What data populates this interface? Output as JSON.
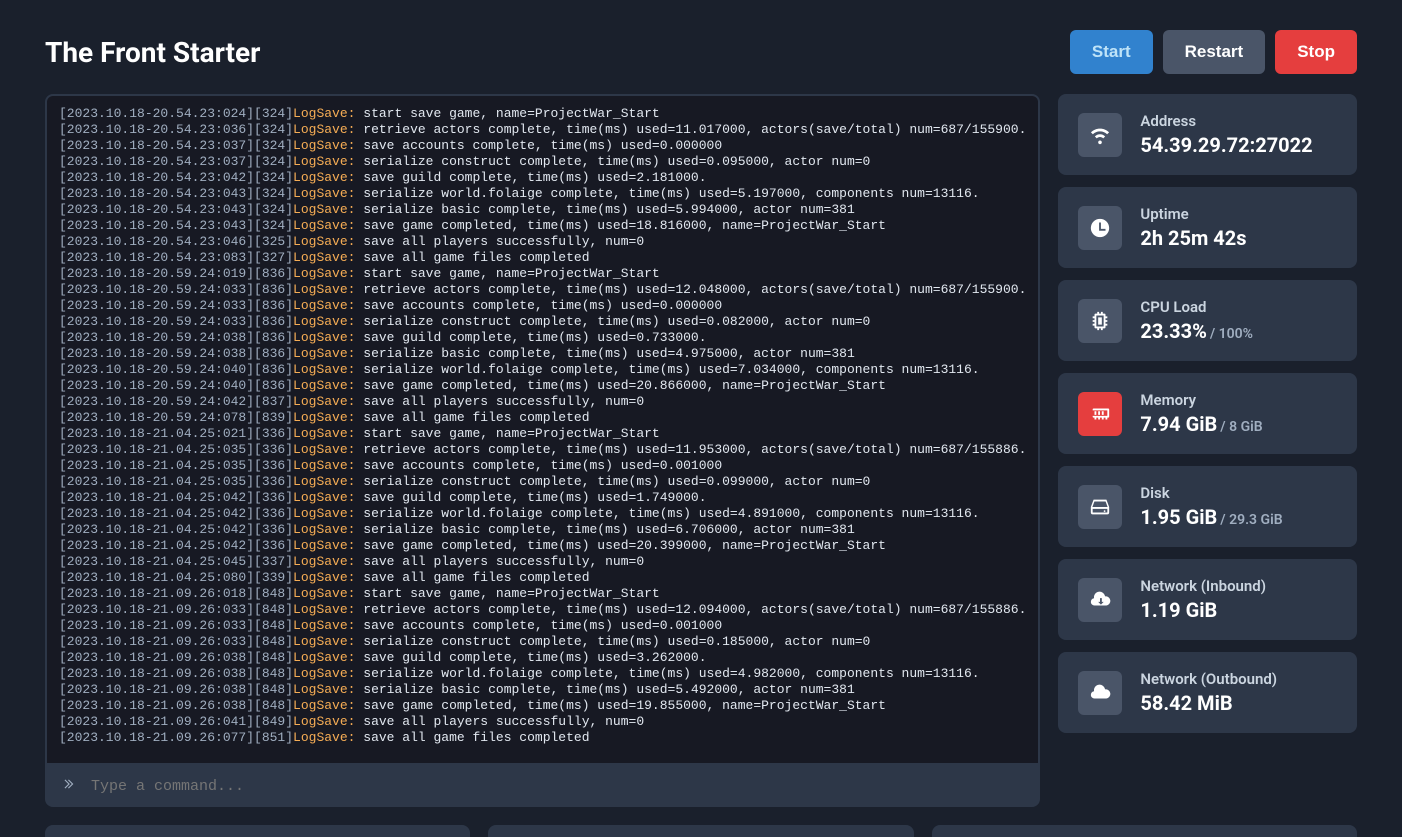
{
  "title": "The Front Starter",
  "buttons": {
    "start": "Start",
    "restart": "Restart",
    "stop": "Stop"
  },
  "console": {
    "placeholder": "Type a command...",
    "lines": [
      {
        "ts": "[2023.10.18-20.54.23:024][324]",
        "tag": "LogSave:",
        "msg": " start save game, name=ProjectWar_Start"
      },
      {
        "ts": "[2023.10.18-20.54.23:036][324]",
        "tag": "LogSave:",
        "msg": " retrieve actors complete, time(ms) used=11.017000, actors(save/total) num=687/155900."
      },
      {
        "ts": "[2023.10.18-20.54.23:037][324]",
        "tag": "LogSave:",
        "msg": " save accounts complete, time(ms) used=0.000000"
      },
      {
        "ts": "[2023.10.18-20.54.23:037][324]",
        "tag": "LogSave:",
        "msg": " serialize construct complete, time(ms) used=0.095000, actor num=0"
      },
      {
        "ts": "[2023.10.18-20.54.23:042][324]",
        "tag": "LogSave:",
        "msg": " save guild complete, time(ms) used=2.181000."
      },
      {
        "ts": "[2023.10.18-20.54.23:043][324]",
        "tag": "LogSave:",
        "msg": " serialize world.folaige complete, time(ms) used=5.197000, components num=13116."
      },
      {
        "ts": "[2023.10.18-20.54.23:043][324]",
        "tag": "LogSave:",
        "msg": " serialize basic complete, time(ms) used=5.994000, actor num=381"
      },
      {
        "ts": "[2023.10.18-20.54.23:043][324]",
        "tag": "LogSave:",
        "msg": " save game completed, time(ms) used=18.816000, name=ProjectWar_Start"
      },
      {
        "ts": "[2023.10.18-20.54.23:046][325]",
        "tag": "LogSave:",
        "msg": " save all players successfully, num=0"
      },
      {
        "ts": "[2023.10.18-20.54.23:083][327]",
        "tag": "LogSave:",
        "msg": " save all game files completed"
      },
      {
        "ts": "[2023.10.18-20.59.24:019][836]",
        "tag": "LogSave:",
        "msg": " start save game, name=ProjectWar_Start"
      },
      {
        "ts": "[2023.10.18-20.59.24:033][836]",
        "tag": "LogSave:",
        "msg": " retrieve actors complete, time(ms) used=12.048000, actors(save/total) num=687/155900."
      },
      {
        "ts": "[2023.10.18-20.59.24:033][836]",
        "tag": "LogSave:",
        "msg": " save accounts complete, time(ms) used=0.000000"
      },
      {
        "ts": "[2023.10.18-20.59.24:033][836]",
        "tag": "LogSave:",
        "msg": " serialize construct complete, time(ms) used=0.082000, actor num=0"
      },
      {
        "ts": "[2023.10.18-20.59.24:038][836]",
        "tag": "LogSave:",
        "msg": " save guild complete, time(ms) used=0.733000."
      },
      {
        "ts": "[2023.10.18-20.59.24:038][836]",
        "tag": "LogSave:",
        "msg": " serialize basic complete, time(ms) used=4.975000, actor num=381"
      },
      {
        "ts": "[2023.10.18-20.59.24:040][836]",
        "tag": "LogSave:",
        "msg": " serialize world.folaige complete, time(ms) used=7.034000, components num=13116."
      },
      {
        "ts": "[2023.10.18-20.59.24:040][836]",
        "tag": "LogSave:",
        "msg": " save game completed, time(ms) used=20.866000, name=ProjectWar_Start"
      },
      {
        "ts": "[2023.10.18-20.59.24:042][837]",
        "tag": "LogSave:",
        "msg": " save all players successfully, num=0"
      },
      {
        "ts": "[2023.10.18-20.59.24:078][839]",
        "tag": "LogSave:",
        "msg": " save all game files completed"
      },
      {
        "ts": "[2023.10.18-21.04.25:021][336]",
        "tag": "LogSave:",
        "msg": " start save game, name=ProjectWar_Start"
      },
      {
        "ts": "[2023.10.18-21.04.25:035][336]",
        "tag": "LogSave:",
        "msg": " retrieve actors complete, time(ms) used=11.953000, actors(save/total) num=687/155886."
      },
      {
        "ts": "[2023.10.18-21.04.25:035][336]",
        "tag": "LogSave:",
        "msg": " save accounts complete, time(ms) used=0.001000"
      },
      {
        "ts": "[2023.10.18-21.04.25:035][336]",
        "tag": "LogSave:",
        "msg": " serialize construct complete, time(ms) used=0.099000, actor num=0"
      },
      {
        "ts": "[2023.10.18-21.04.25:042][336]",
        "tag": "LogSave:",
        "msg": " save guild complete, time(ms) used=1.749000."
      },
      {
        "ts": "[2023.10.18-21.04.25:042][336]",
        "tag": "LogSave:",
        "msg": " serialize world.folaige complete, time(ms) used=4.891000, components num=13116."
      },
      {
        "ts": "[2023.10.18-21.04.25:042][336]",
        "tag": "LogSave:",
        "msg": " serialize basic complete, time(ms) used=6.706000, actor num=381"
      },
      {
        "ts": "[2023.10.18-21.04.25:042][336]",
        "tag": "LogSave:",
        "msg": " save game completed, time(ms) used=20.399000, name=ProjectWar_Start"
      },
      {
        "ts": "[2023.10.18-21.04.25:045][337]",
        "tag": "LogSave:",
        "msg": " save all players successfully, num=0"
      },
      {
        "ts": "[2023.10.18-21.04.25:080][339]",
        "tag": "LogSave:",
        "msg": " save all game files completed"
      },
      {
        "ts": "[2023.10.18-21.09.26:018][848]",
        "tag": "LogSave:",
        "msg": " start save game, name=ProjectWar_Start"
      },
      {
        "ts": "[2023.10.18-21.09.26:033][848]",
        "tag": "LogSave:",
        "msg": " retrieve actors complete, time(ms) used=12.094000, actors(save/total) num=687/155886."
      },
      {
        "ts": "[2023.10.18-21.09.26:033][848]",
        "tag": "LogSave:",
        "msg": " save accounts complete, time(ms) used=0.001000"
      },
      {
        "ts": "[2023.10.18-21.09.26:033][848]",
        "tag": "LogSave:",
        "msg": " serialize construct complete, time(ms) used=0.185000, actor num=0"
      },
      {
        "ts": "[2023.10.18-21.09.26:038][848]",
        "tag": "LogSave:",
        "msg": " save guild complete, time(ms) used=3.262000."
      },
      {
        "ts": "[2023.10.18-21.09.26:038][848]",
        "tag": "LogSave:",
        "msg": " serialize world.folaige complete, time(ms) used=4.982000, components num=13116."
      },
      {
        "ts": "[2023.10.18-21.09.26:038][848]",
        "tag": "LogSave:",
        "msg": " serialize basic complete, time(ms) used=5.492000, actor num=381"
      },
      {
        "ts": "[2023.10.18-21.09.26:038][848]",
        "tag": "LogSave:",
        "msg": " save game completed, time(ms) used=19.855000, name=ProjectWar_Start"
      },
      {
        "ts": "[2023.10.18-21.09.26:041][849]",
        "tag": "LogSave:",
        "msg": " save all players successfully, num=0"
      },
      {
        "ts": "[2023.10.18-21.09.26:077][851]",
        "tag": "LogSave:",
        "msg": " save all game files completed"
      }
    ]
  },
  "stats": {
    "address": {
      "label": "Address",
      "value": "54.39.29.72:27022",
      "sub": ""
    },
    "uptime": {
      "label": "Uptime",
      "value": "2h 25m 42s",
      "sub": ""
    },
    "cpu": {
      "label": "CPU Load",
      "value": "23.33%",
      "sub": "/ 100%"
    },
    "memory": {
      "label": "Memory",
      "value": "7.94 GiB",
      "sub": "/ 8 GiB"
    },
    "disk": {
      "label": "Disk",
      "value": "1.95 GiB",
      "sub": "/ 29.3 GiB"
    },
    "net_in": {
      "label": "Network (Inbound)",
      "value": "1.19 GiB",
      "sub": ""
    },
    "net_out": {
      "label": "Network (Outbound)",
      "value": "58.42 MiB",
      "sub": ""
    }
  }
}
